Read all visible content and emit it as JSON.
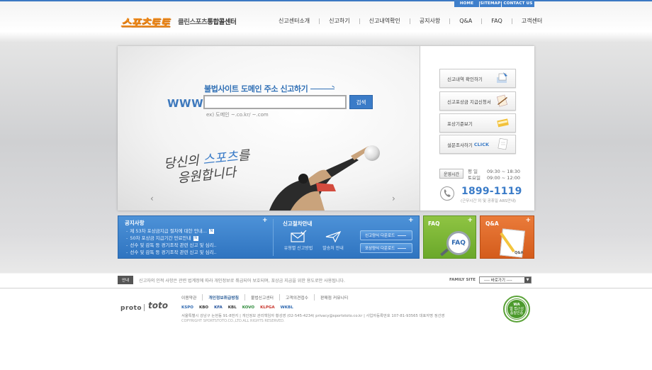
{
  "util_nav": {
    "home": "HOME",
    "sitemap": "SITEMAP",
    "contact": "CONTACT US"
  },
  "logo": {
    "main": "스포츠토토",
    "sub_light": "클린스포츠",
    "sub_bold": "통합콜센터"
  },
  "nav": [
    "신고센터소개",
    "신고하기",
    "신고내역확인",
    "공지사항",
    "Q&A",
    "FAQ",
    "고객센터"
  ],
  "hero": {
    "report_title": "불법사이트 도메인 주소 신고하기",
    "www_label": "WWW.",
    "input_value": "",
    "search_button": "검색",
    "example": "ex) 도메인 ~.co.kr/ ~.com",
    "slogan_a": "당신의",
    "slogan_hl": "스포츠",
    "slogan_b": "를",
    "slogan_c": "응원합니다",
    "prev": "‹",
    "next": "›"
  },
  "side_menu": [
    {
      "label": "신고내역 확인하기"
    },
    {
      "label": "신고포상금 지급신청서"
    },
    {
      "label": "포상기준보기"
    },
    {
      "label": "설문조사하기",
      "extra": "CLICK"
    }
  ],
  "hours": {
    "badge": "운영시간",
    "weekday_label": "평    일",
    "weekday": "09:30 ~ 18:30",
    "sat_label": "토요일",
    "sat": "09:00 ~ 12:00",
    "phone": "1899-1119",
    "phone_note": "(근무시간 외 및 공휴일 ARS안내)"
  },
  "notice": {
    "title": "공지사항",
    "items": [
      {
        "text": "제 53차 포상금지급 절차에 대한 안내...",
        "new": "N"
      },
      {
        "text": "50차 포상금 지급기간 만료안내",
        "new": "N"
      },
      {
        "text": "선수 및 감독 등 경기조작 관련 신고 및 심리..",
        "new": ""
      },
      {
        "text": "선수 및 감독 등 경기조작 관련 신고 및 심리..",
        "new": ""
      }
    ]
  },
  "guide": {
    "title": "신고절차안내",
    "icon1_label": "유형별 신고방법",
    "icon2_label": "발송처 안내",
    "download1": "신고양식 다운로드",
    "download2": "포상양식 다운로드"
  },
  "faq": {
    "title": "FAQ",
    "badge": "FAQ"
  },
  "qna": {
    "title": "Q&A",
    "doc": "Q&A"
  },
  "privacy": {
    "tag": "안내",
    "text": "신고자의 인적 사항은 관련 법계정에 따라 개인정보로 취급되어 보호되며, 포상금 지급을 위한 용도로만 사용됩니다."
  },
  "family_site": {
    "label": "FAMILY SITE",
    "value": "---- 바로가기 ----"
  },
  "footer": {
    "brand_proto": "proto",
    "brand_toto": "toto",
    "links": [
      "이용약관",
      "개인정보취급방침",
      "불법신고센터",
      "고객의견접수",
      "판매점 커뮤니티"
    ],
    "partners": [
      "KSPO",
      "KBO",
      "KFA",
      "KBL",
      "KOVO",
      "KLPGA",
      "WKBL"
    ],
    "address": "서울특별시 강남구 논현동 91-8번지  |  개인정보 관리책임자 황성영 (02-545-4234) privacy@sportstoto.co.kr  |  사업자등록번호 107-81-93565 대표자명 정선영",
    "copyright": "COPYRIGHT SPORTSTOTO.CO.,LTD.ALL RIGHTS RESERVED.",
    "cert_line1": "WA",
    "cert_line2": "웹 접근성",
    "cert_line3": "품질인증"
  },
  "colors": {
    "accent_blue": "#3b7cc8",
    "logo_orange": "#ef8a1b",
    "faq_green": "#7bb636",
    "qna_orange": "#e06a2a"
  }
}
